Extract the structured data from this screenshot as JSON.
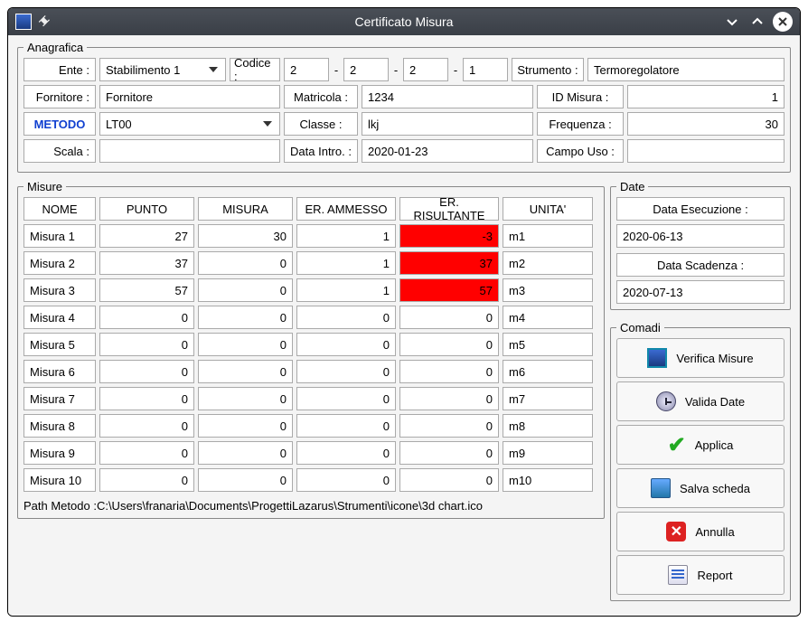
{
  "window": {
    "title": "Certificato Misura"
  },
  "anagrafica": {
    "legend": "Anagrafica",
    "labels": {
      "ente": "Ente :",
      "codice": "Codice :",
      "strumento": "Strumento :",
      "fornitore": "Fornitore :",
      "matricola": "Matricola :",
      "idmisura": "ID Misura :",
      "metodo": "METODO",
      "classe": "Classe :",
      "frequenza": "Frequenza :",
      "scala": "Scala :",
      "dataintro": "Data Intro. :",
      "campouso": "Campo Uso :"
    },
    "values": {
      "ente": "Stabilimento 1",
      "codice": [
        "2",
        "2",
        "2",
        "1"
      ],
      "strumento": "Termoregolatore",
      "fornitore": "Fornitore",
      "matricola": "1234",
      "idmisura": "1",
      "metodo": "LT00",
      "classe": "lkj",
      "frequenza": "30",
      "scala": "",
      "dataintro": "2020-01-23",
      "campouso": ""
    }
  },
  "misure": {
    "legend": "Misure",
    "headers": {
      "nome": "NOME",
      "punto": "PUNTO",
      "misura": "MISURA",
      "eramm": "ER. AMMESSO",
      "erris": "ER. RISULTANTE",
      "unita": "UNITA'"
    },
    "rows": [
      {
        "nome": "Misura 1",
        "punto": "27",
        "misura": "30",
        "eramm": "1",
        "erris": "-3",
        "unita": "m1",
        "alert": true
      },
      {
        "nome": "Misura 2",
        "punto": "37",
        "misura": "0",
        "eramm": "1",
        "erris": "37",
        "unita": "m2",
        "alert": true
      },
      {
        "nome": "Misura 3",
        "punto": "57",
        "misura": "0",
        "eramm": "1",
        "erris": "57",
        "unita": "m3",
        "alert": true
      },
      {
        "nome": "Misura 4",
        "punto": "0",
        "misura": "0",
        "eramm": "0",
        "erris": "0",
        "unita": "m4",
        "alert": false
      },
      {
        "nome": "Misura 5",
        "punto": "0",
        "misura": "0",
        "eramm": "0",
        "erris": "0",
        "unita": "m5",
        "alert": false
      },
      {
        "nome": "Misura 6",
        "punto": "0",
        "misura": "0",
        "eramm": "0",
        "erris": "0",
        "unita": "m6",
        "alert": false
      },
      {
        "nome": "Misura 7",
        "punto": "0",
        "misura": "0",
        "eramm": "0",
        "erris": "0",
        "unita": "m7",
        "alert": false
      },
      {
        "nome": "Misura 8",
        "punto": "0",
        "misura": "0",
        "eramm": "0",
        "erris": "0",
        "unita": "m8",
        "alert": false
      },
      {
        "nome": "Misura 9",
        "punto": "0",
        "misura": "0",
        "eramm": "0",
        "erris": "0",
        "unita": "m9",
        "alert": false
      },
      {
        "nome": "Misura 10",
        "punto": "0",
        "misura": "0",
        "eramm": "0",
        "erris": "0",
        "unita": "m10",
        "alert": false
      }
    ]
  },
  "date": {
    "legend": "Date",
    "label_esecuzione": "Data Esecuzione :",
    "esecuzione": "2020-06-13",
    "label_scadenza": "Data Scadenza :",
    "scadenza": "2020-07-13"
  },
  "comandi": {
    "legend": "Comadi",
    "verifica": "Verifica Misure",
    "valida": "Valida Date",
    "applica": "Applica",
    "salva": "Salva scheda",
    "annulla": "Annulla",
    "report": "Report"
  },
  "path": "Path Metodo :C:\\Users\\franaria\\Documents\\ProgettiLazarus\\Strumenti\\icone\\3d chart.ico"
}
